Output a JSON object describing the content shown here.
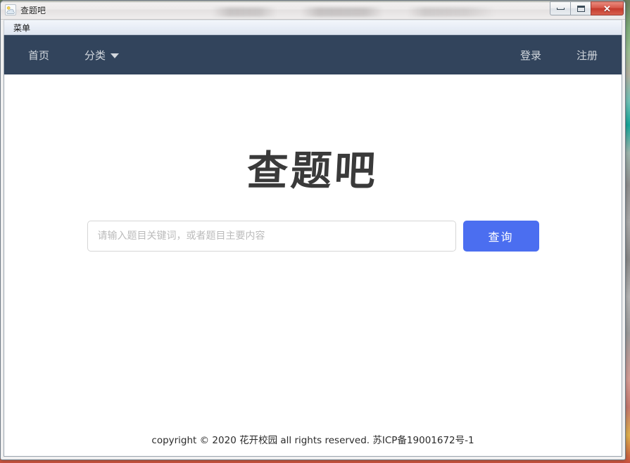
{
  "window": {
    "title": "查题吧",
    "icon": "app-cloud-icon",
    "controls": {
      "minimize_label": "",
      "maximize_label": "",
      "close_label": "✕"
    }
  },
  "menu_bar": {
    "items": [
      {
        "label": "菜单"
      }
    ]
  },
  "site": {
    "navbar": {
      "background_color": "#32445c",
      "left_items": [
        {
          "label": "首页",
          "icon": null
        },
        {
          "label": "分类",
          "icon": "chevron-down-icon"
        }
      ],
      "right_items": [
        {
          "label": "登录"
        },
        {
          "label": "注册"
        }
      ]
    },
    "hero": {
      "logo_title": "查题吧",
      "search": {
        "placeholder": "请输入题目关键词，或者题目主要内容",
        "value": "",
        "button_label": "查询",
        "button_color": "#4b6ef0"
      }
    },
    "footer": {
      "text": "copyright © 2020 花开校园 all rights reserved. 苏ICP备19001672号-1"
    }
  }
}
